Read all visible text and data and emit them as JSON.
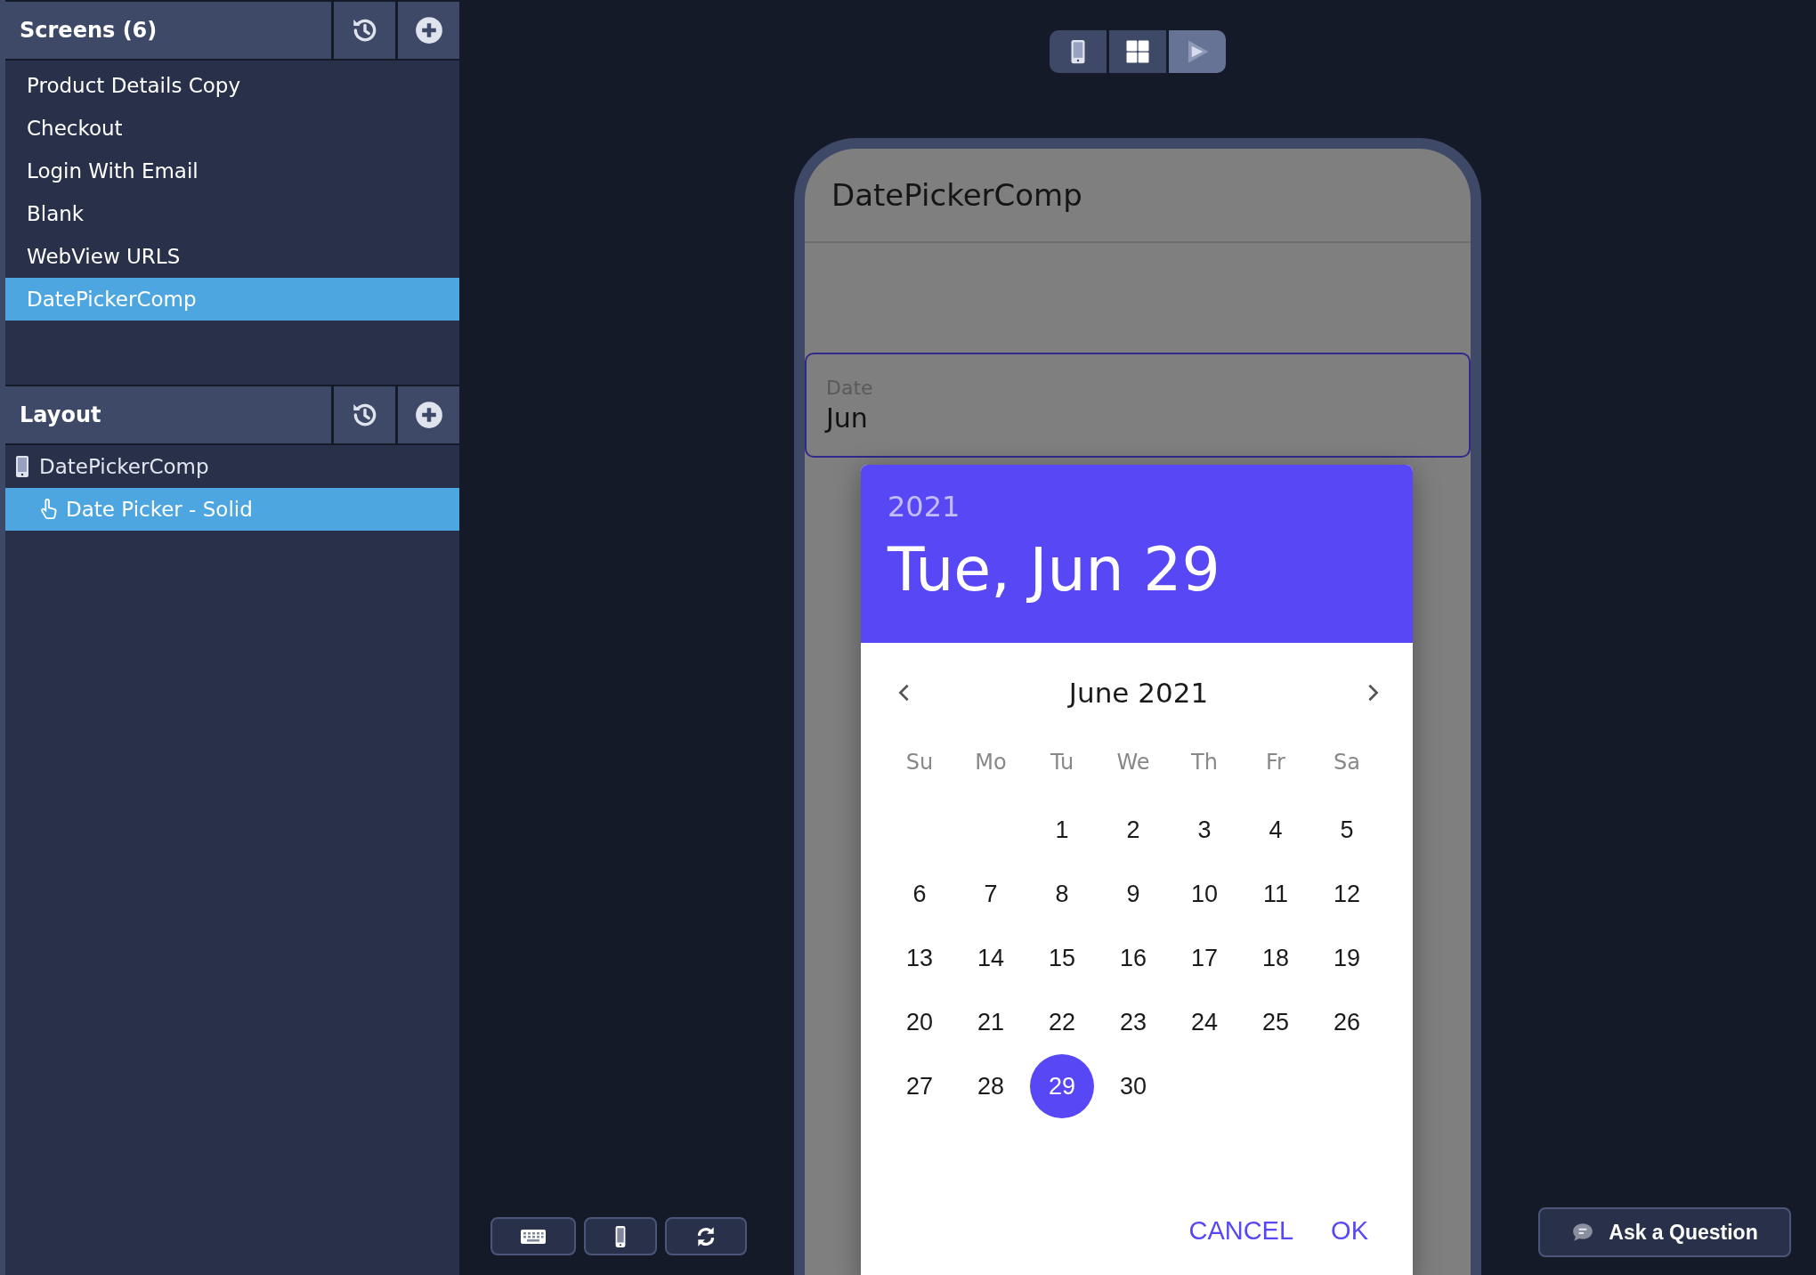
{
  "sidebar": {
    "screens": {
      "title": "Screens (6)",
      "items": [
        {
          "label": "Product Details Copy",
          "selected": false
        },
        {
          "label": "Checkout",
          "selected": false
        },
        {
          "label": "Login With Email",
          "selected": false
        },
        {
          "label": "Blank",
          "selected": false
        },
        {
          "label": "WebView URLS",
          "selected": false
        },
        {
          "label": "DatePickerComp",
          "selected": true
        }
      ]
    },
    "layout": {
      "title": "Layout",
      "tree": [
        {
          "label": "DatePickerComp",
          "kind": "screen",
          "selected": false,
          "children": [
            {
              "label": "Date Picker - Solid",
              "kind": "component",
              "selected": true
            }
          ]
        }
      ]
    }
  },
  "toolbar": {
    "modes": [
      {
        "kind": "device",
        "selected": false
      },
      {
        "kind": "grid",
        "selected": false
      },
      {
        "kind": "play",
        "selected": true
      }
    ]
  },
  "phone": {
    "title": "DatePickerComp",
    "field": {
      "label": "Date",
      "value": "Jun"
    }
  },
  "dialog": {
    "year": "2021",
    "date": "Tue, Jun 29",
    "month": "June 2021",
    "weekdays": [
      "Su",
      "Mo",
      "Tu",
      "We",
      "Th",
      "Fr",
      "Sa"
    ],
    "weeks": [
      [
        {
          "kind": "blank"
        },
        {
          "kind": "blank"
        },
        {
          "kind": "day",
          "label": "1",
          "selected": false
        },
        {
          "kind": "day",
          "label": "2",
          "selected": false
        },
        {
          "kind": "day",
          "label": "3",
          "selected": false
        },
        {
          "kind": "day",
          "label": "4",
          "selected": false
        },
        {
          "kind": "day",
          "label": "5",
          "selected": false
        }
      ],
      [
        {
          "kind": "day",
          "label": "6",
          "selected": false
        },
        {
          "kind": "day",
          "label": "7",
          "selected": false
        },
        {
          "kind": "day",
          "label": "8",
          "selected": false
        },
        {
          "kind": "day",
          "label": "9",
          "selected": false
        },
        {
          "kind": "day",
          "label": "10",
          "selected": false
        },
        {
          "kind": "day",
          "label": "11",
          "selected": false
        },
        {
          "kind": "day",
          "label": "12",
          "selected": false
        }
      ],
      [
        {
          "kind": "day",
          "label": "13",
          "selected": false
        },
        {
          "kind": "day",
          "label": "14",
          "selected": false
        },
        {
          "kind": "day",
          "label": "15",
          "selected": false
        },
        {
          "kind": "day",
          "label": "16",
          "selected": false
        },
        {
          "kind": "day",
          "label": "17",
          "selected": false
        },
        {
          "kind": "day",
          "label": "18",
          "selected": false
        },
        {
          "kind": "day",
          "label": "19",
          "selected": false
        }
      ],
      [
        {
          "kind": "day",
          "label": "20",
          "selected": false
        },
        {
          "kind": "day",
          "label": "21",
          "selected": false
        },
        {
          "kind": "day",
          "label": "22",
          "selected": false
        },
        {
          "kind": "day",
          "label": "23",
          "selected": false
        },
        {
          "kind": "day",
          "label": "24",
          "selected": false
        },
        {
          "kind": "day",
          "label": "25",
          "selected": false
        },
        {
          "kind": "day",
          "label": "26",
          "selected": false
        }
      ],
      [
        {
          "kind": "day",
          "label": "27",
          "selected": false
        },
        {
          "kind": "day",
          "label": "28",
          "selected": false
        },
        {
          "kind": "day",
          "label": "29",
          "selected": true
        },
        {
          "kind": "day",
          "label": "30",
          "selected": false
        }
      ]
    ],
    "actions": [
      "CANCEL",
      "OK"
    ]
  },
  "bottom_toolbar": [
    {
      "kind": "keyboard"
    },
    {
      "kind": "device"
    },
    {
      "kind": "refresh"
    }
  ],
  "help_button": {
    "label": "Ask a Question"
  }
}
